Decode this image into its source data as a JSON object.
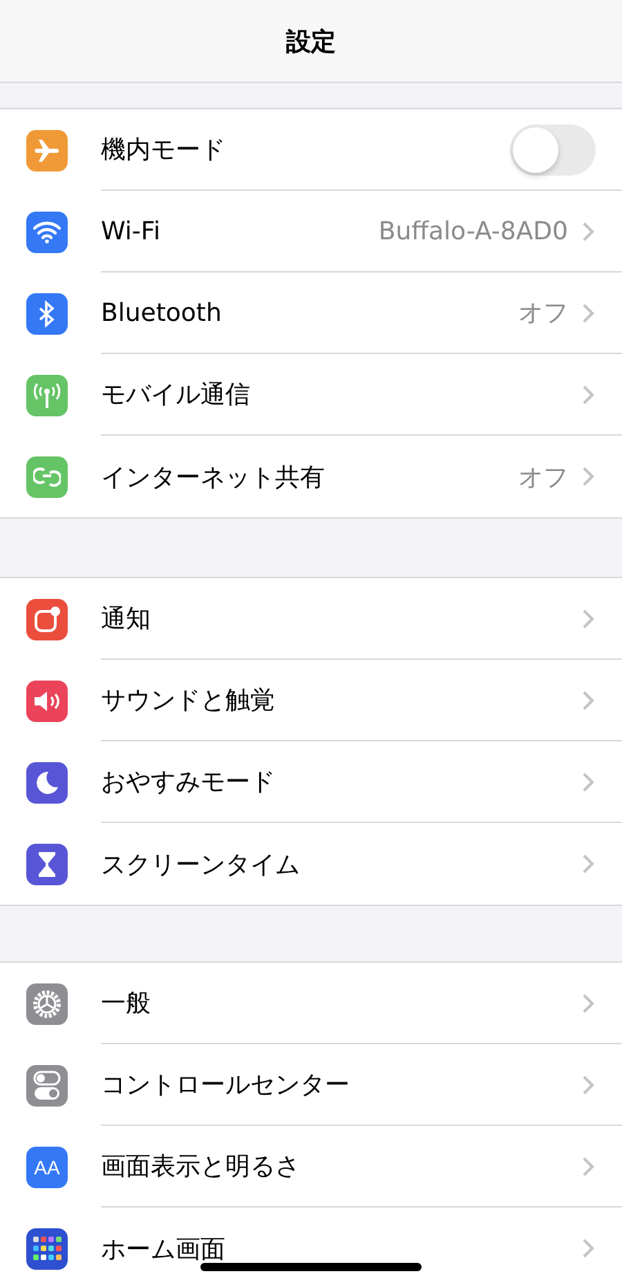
{
  "header": {
    "title": "設定"
  },
  "groups": [
    {
      "items": [
        {
          "kind": "toggle",
          "label": "機内モード",
          "on": false
        },
        {
          "kind": "link",
          "label": "Wi-Fi",
          "value": "Buffalo-A-8AD0"
        },
        {
          "kind": "link",
          "label": "Bluetooth",
          "value": "オフ"
        },
        {
          "kind": "link",
          "label": "モバイル通信"
        },
        {
          "kind": "link",
          "label": "インターネット共有",
          "value": "オフ"
        }
      ]
    },
    {
      "items": [
        {
          "kind": "link",
          "label": "通知"
        },
        {
          "kind": "link",
          "label": "サウンドと触覚"
        },
        {
          "kind": "link",
          "label": "おやすみモード"
        },
        {
          "kind": "link",
          "label": "スクリーンタイム"
        }
      ]
    },
    {
      "items": [
        {
          "kind": "link",
          "label": "一般"
        },
        {
          "kind": "link",
          "label": "コントロールセンター"
        },
        {
          "kind": "link",
          "label": "画面表示と明るさ",
          "icon_label": "AA"
        },
        {
          "kind": "link",
          "label": "ホーム画面"
        }
      ]
    }
  ]
}
